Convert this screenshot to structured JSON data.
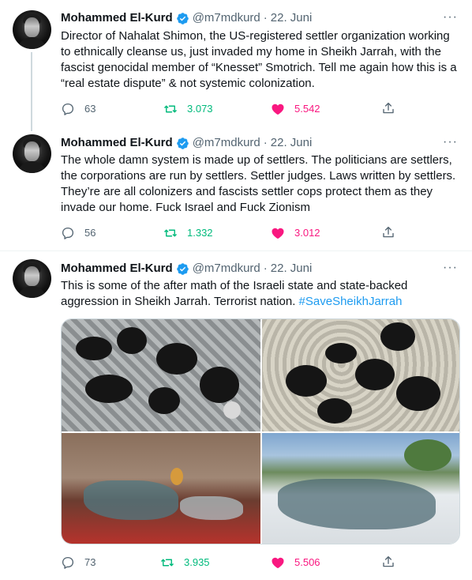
{
  "colors": {
    "text": "#0f1419",
    "secondary": "#536471",
    "link": "#1d9bf0",
    "retweet": "#00ba7c",
    "like": "#f91880",
    "verified": "#1d9bf0"
  },
  "tweets": [
    {
      "author": {
        "name": "Mohammed El-Kurd",
        "handle": "@m7mdkurd",
        "verified": true
      },
      "date": "22. Juni",
      "text": "Director of Nahalat Shimon, the US-registered settler organization working to ethnically cleanse us, just invaded my home in Sheikh Jarrah, with the fascist genocidal member of “Knesset” Smotrich. Tell me again how this is a “real estate dispute” & not systemic colonization.",
      "replies": "63",
      "retweets": "3.073",
      "likes": "5.542",
      "liked": true
    },
    {
      "author": {
        "name": "Mohammed El-Kurd",
        "handle": "@m7mdkurd",
        "verified": true
      },
      "date": "22. Juni",
      "text": "The whole damn system is made up of settlers. The politicians are settlers, the corporations are run by settlers. Settler judges. Laws written by settlers. They’re are all colonizers and fascists settler cops protect them as they invade our home. Fuck Israel and Fuck Zionism",
      "replies": "56",
      "retweets": "1.332",
      "likes": "3.012",
      "liked": true
    },
    {
      "author": {
        "name": "Mohammed El-Kurd",
        "handle": "@m7mdkurd",
        "verified": true
      },
      "date": "22. Juni",
      "text": "This is some of the after math of the Israeli state and state-backed aggression in Sheikh Jarrah. Terrorist nation. ",
      "hashtag": "#SaveSheikhJarrah",
      "media_count": 4,
      "replies": "73",
      "retweets": "3.935",
      "likes": "5.506",
      "liked": true
    }
  ],
  "labels": {
    "dot": "·",
    "more": "···"
  }
}
